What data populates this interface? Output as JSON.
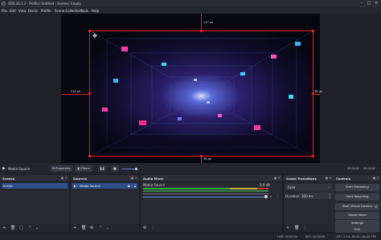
{
  "window": {
    "title": "OBS 30.1.2 - Profile: Untitled - Scenes: Empty",
    "controls": [
      "–",
      "□",
      "×"
    ]
  },
  "menu": [
    "File",
    "Edit",
    "View",
    "Docks",
    "Profile",
    "Scene Collection",
    "Tools",
    "Help"
  ],
  "preview": {
    "top_distance": "117 px",
    "left_distance": "214 px",
    "right_distance": "38 px",
    "bottom_distance": "38 px",
    "colors": {
      "guide": "#e01e1e",
      "canvas": "#070710"
    }
  },
  "media_bar": {
    "source_name": "Media Source",
    "properties": "Properties",
    "filters": "Filters",
    "time_current": "00:00:00",
    "time_total": "00:00:00"
  },
  "scenes": {
    "header": "Scenes",
    "items": [
      "Scene"
    ],
    "footer_icons": [
      "+",
      "🗑",
      "▢",
      "⌃",
      "⌄"
    ]
  },
  "sources": {
    "header": "Sources",
    "items": [
      "Media Source"
    ],
    "footer_icons": [
      "+",
      "🗑",
      "⚙",
      "⌃",
      "⌄"
    ]
  },
  "audio_mixer": {
    "header": "Audio Mixer",
    "channel_name": "Media Source",
    "level": "0.0 dB",
    "footer_icons": [
      "⚙",
      "⋮"
    ]
  },
  "transitions": {
    "header": "Scene Transitions",
    "type": "Fade",
    "duration_label": "Duration",
    "duration_value": "300 ms",
    "footer_icons": [
      "+",
      "🗑",
      "⋮"
    ]
  },
  "controls": {
    "header": "Controls",
    "buttons": [
      "Start Streaming",
      "Start Recording",
      "Start Virtual Camera",
      "Studio Mode",
      "Settings",
      "Exit"
    ]
  },
  "status": {
    "live": "LIVE: 00:00:00",
    "rec": "REC: 00:00:00",
    "cpu": "CPU: 2.4%, 60.00 / 60.00 FPS"
  }
}
